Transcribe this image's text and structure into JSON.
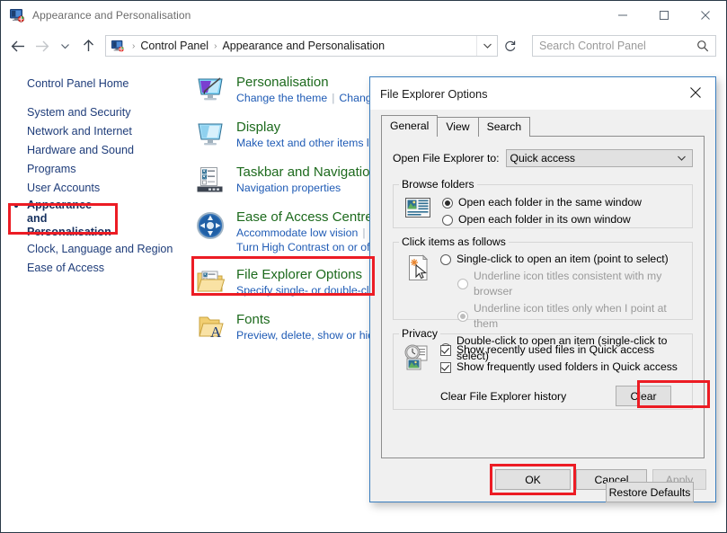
{
  "window": {
    "title": "Appearance and Personalisation",
    "icon": "control-panel-icon",
    "minimize": "—",
    "maximize": "□",
    "close": "✕"
  },
  "navbar": {
    "back": "back-arrow",
    "forward": "forward-arrow",
    "recent": "recent-locations-chevron",
    "up": "up-arrow",
    "breadcrumbs": [
      "Control Panel",
      "Appearance and Personalisation"
    ],
    "separator": "›",
    "dropdown": "chevron-down-icon",
    "refresh": "refresh-icon"
  },
  "search": {
    "placeholder": "Search Control Panel",
    "icon": "search-icon"
  },
  "sidebar": {
    "home": "Control Panel Home",
    "items": [
      {
        "label": "System and Security",
        "selected": false
      },
      {
        "label": "Network and Internet",
        "selected": false
      },
      {
        "label": "Hardware and Sound",
        "selected": false
      },
      {
        "label": "Programs",
        "selected": false
      },
      {
        "label": "User Accounts",
        "selected": false
      },
      {
        "label": "Appearance and Personalisation",
        "selected": true
      },
      {
        "label": "Clock, Language and Region",
        "selected": false
      },
      {
        "label": "Ease of Access",
        "selected": false
      }
    ]
  },
  "categories": [
    {
      "title": "Personalisation",
      "icon": "personalisation-icon",
      "links": [
        "Change the theme",
        "Chang"
      ],
      "highlighted": false
    },
    {
      "title": "Display",
      "icon": "display-icon",
      "links": [
        "Make text and other items la"
      ],
      "highlighted": false
    },
    {
      "title": "Taskbar and Navigatio",
      "icon": "taskbar-icon",
      "links": [
        "Navigation properties"
      ],
      "highlighted": false
    },
    {
      "title": "Ease of Access Centre",
      "icon": "ease-of-access-icon",
      "links": [
        "Accommodate low vision",
        "Turn High Contrast on or off"
      ],
      "highlighted": false
    },
    {
      "title": "File Explorer Options",
      "icon": "file-explorer-options-icon",
      "links": [
        "Specify single- or double-cl"
      ],
      "highlighted": true
    },
    {
      "title": "Fonts",
      "icon": "fonts-icon",
      "links": [
        "Preview, delete, show or hide"
      ],
      "highlighted": false
    }
  ],
  "dialog": {
    "title": "File Explorer Options",
    "close_icon": "close-icon",
    "tabs": [
      {
        "label": "General",
        "active": true
      },
      {
        "label": "View",
        "active": false
      },
      {
        "label": "Search",
        "active": false
      }
    ],
    "open_explorer": {
      "label": "Open File Explorer to:",
      "value": "Quick access",
      "arrow": "chevron-down-icon"
    },
    "browse_folders": {
      "legend": "Browse folders",
      "icon": "browse-folders-icon",
      "options": [
        {
          "label": "Open each folder in the same window",
          "checked": true
        },
        {
          "label": "Open each folder in its own window",
          "checked": false
        }
      ]
    },
    "click_items": {
      "legend": "Click items as follows",
      "icon": "click-items-icon",
      "options": [
        {
          "label": "Single-click to open an item (point to select)",
          "checked": false,
          "disabled": false,
          "indent": false
        },
        {
          "label": "Underline icon titles consistent with my browser",
          "checked": false,
          "disabled": true,
          "indent": true
        },
        {
          "label": "Underline icon titles only when I point at them",
          "checked": true,
          "disabled": true,
          "indent": true
        },
        {
          "label": "Double-click to open an item (single-click to select)",
          "checked": true,
          "disabled": false,
          "indent": false
        }
      ]
    },
    "privacy": {
      "legend": "Privacy",
      "icon": "privacy-icon",
      "checkboxes": [
        {
          "label": "Show recently used files in Quick access",
          "checked": true
        },
        {
          "label": "Show frequently used folders in Quick access",
          "checked": true
        }
      ],
      "history_label": "Clear File Explorer history",
      "clear_button": "Clear",
      "clear_highlighted": true
    },
    "restore_defaults": "Restore Defaults",
    "buttons": {
      "ok": "OK",
      "cancel": "Cancel",
      "apply": "Apply",
      "ok_highlighted": true,
      "apply_disabled": true
    }
  },
  "colors": {
    "highlight_box": "#ec1c24",
    "category_title": "#1d6a1d",
    "link": "#1f5bb5",
    "nav_link": "#1f3d7a",
    "dialog_border": "#3a7ebf"
  }
}
